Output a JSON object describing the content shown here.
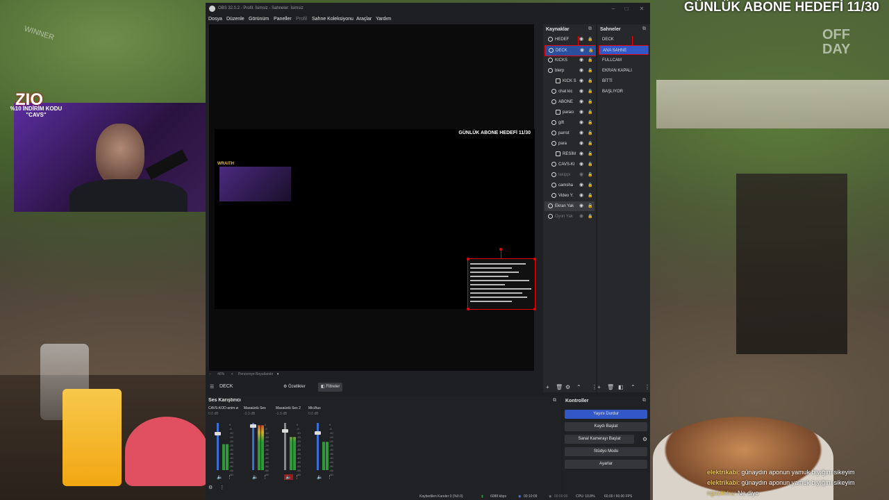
{
  "overlay": {
    "goal_top": "GÜNLÜK ABONE HEDEFİ 11/30",
    "off_day": "OFF DAY",
    "logo": "ZIO",
    "promo": "%10 İNDİRİM KODU \"CAVS\"",
    "winner": "WINNER"
  },
  "obs": {
    "title": "OBS 32.0.2 - Profil: İsimsiz - Sahneler: İsimsiz",
    "menu": [
      "Dosya",
      "Düzenle",
      "Görünüm",
      "Paneller",
      "Profil",
      "Sahne Koleksiyonu",
      "Araçlar",
      "Yardım"
    ],
    "preview": {
      "goal": "GÜNLÜK ABONE HEDEFİ 11/30",
      "wraith": "WRAITH",
      "zoom": "46%",
      "fit_label": "Pencereye Boyutlandır"
    },
    "sources": {
      "title": "Kaynaklar",
      "items": [
        {
          "label": "HEDEF"
        },
        {
          "label": "DECK"
        },
        {
          "label": "KICKS"
        },
        {
          "label": "blerp"
        },
        {
          "label": "KICK S"
        },
        {
          "label": "chat kic"
        },
        {
          "label": "ABONE"
        },
        {
          "label": "paracı"
        },
        {
          "label": "gift"
        },
        {
          "label": "parrot"
        },
        {
          "label": "para"
        },
        {
          "label": "RESİM"
        },
        {
          "label": "CAVS-KI"
        },
        {
          "label": "lakippi"
        },
        {
          "label": "camsha"
        },
        {
          "label": "Video Y."
        },
        {
          "label": "Ekran Yak"
        },
        {
          "label": "Oyun Yak"
        }
      ]
    },
    "scenes": {
      "title": "Sahneler",
      "items": [
        {
          "label": "DECK"
        },
        {
          "label": "ANA SAHNE"
        },
        {
          "label": "FULLCAM"
        },
        {
          "label": "EKRAN KAPALI"
        },
        {
          "label": "BİTTİ"
        },
        {
          "label": "BAŞLIYOR"
        }
      ]
    },
    "scene_bar": {
      "current": "DECK",
      "properties": "Özellikler",
      "filters": "Filtreler"
    },
    "mixer": {
      "title": "Ses Karıştırıcı",
      "channels": [
        {
          "name": "CAVS-KOD-anim.w",
          "db": "0.0 dB",
          "level": 0.55
        },
        {
          "name": "Masaüstü Ses",
          "db": "-3.3 dB",
          "level": 0.95
        },
        {
          "name": "Masaüstü Ses 2",
          "db": "-1.0 dB",
          "level": 0.7
        },
        {
          "name": "Mic/Aux",
          "db": "0.0 dB",
          "level": 0.6
        }
      ],
      "scale": [
        "0",
        "-5",
        "-10",
        "-15",
        "-20",
        "-25",
        "-30",
        "-35",
        "-40",
        "-45",
        "-50",
        "-55",
        "-60"
      ]
    },
    "controls": {
      "title": "Kontroller",
      "stop_stream": "Yayını Durdur",
      "start_record": "Kaydı Başlat",
      "virtual_cam": "Sanal Kamerayı Başlat",
      "studio_mode": "Stüdyo Modu",
      "settings": "Ayarlar"
    },
    "status": {
      "dropped": "Kaybedilen Kareler 0 (%0.0)",
      "bitrate": "6088 kbps",
      "live_time": "00:10:09",
      "rec_time": "00:00:00",
      "cpu": "CPU: 10.8%",
      "fps": "60.00 / 60.00 FPS"
    }
  },
  "chat": [
    {
      "user": "elektrikabi",
      "text": ": günaydın aponun yamuk bıyığını sikeyim"
    },
    {
      "user": "elektrikabi",
      "text": ": günaydın aponun yamuk bıyığını sikeyim"
    },
    {
      "user": "ngozilhfra",
      "text": ": Ne diyo"
    }
  ]
}
